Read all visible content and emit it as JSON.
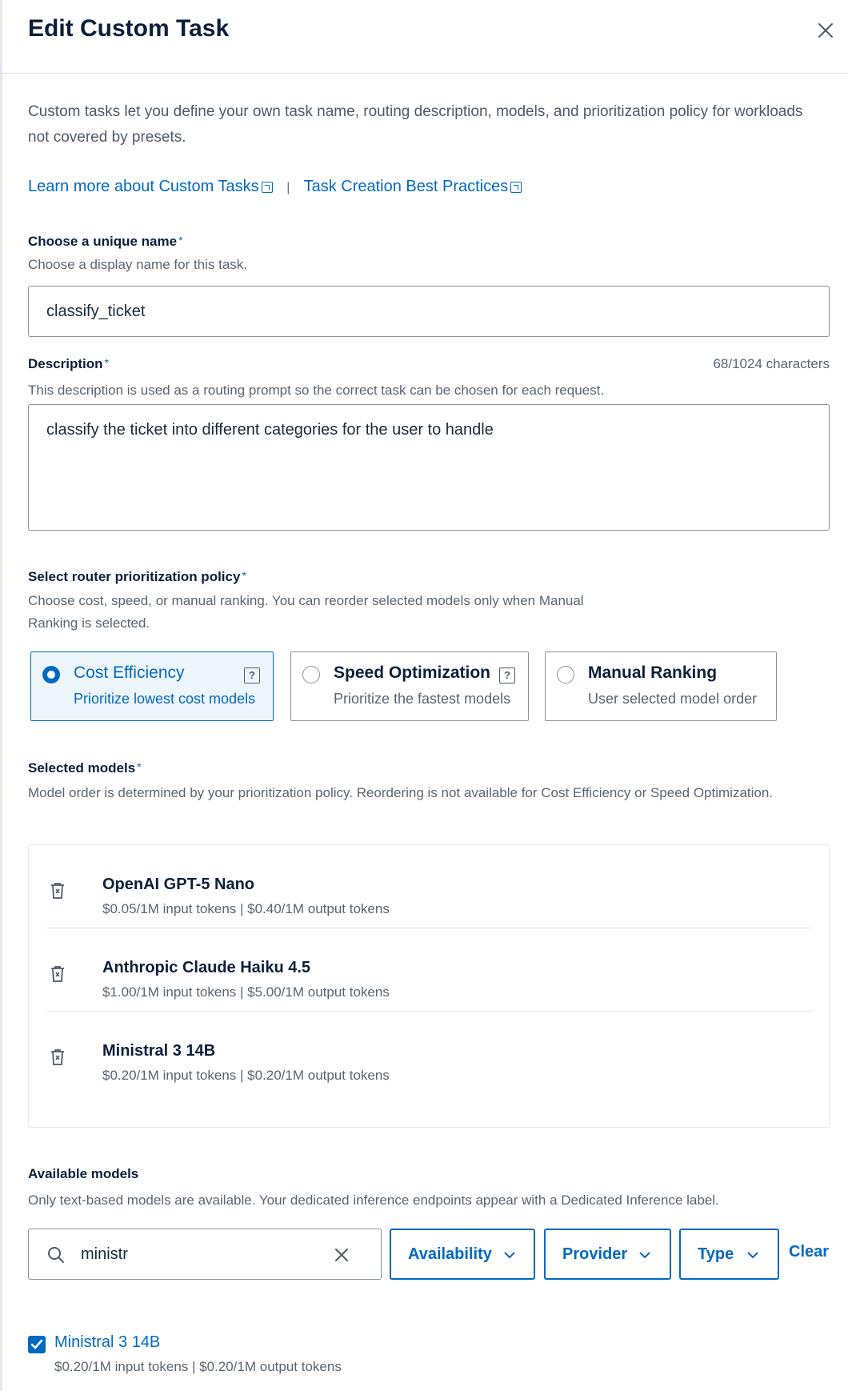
{
  "header": {
    "title": "Edit Custom Task"
  },
  "intro": "Custom tasks let you define your own task name, routing description, models, and prioritization policy for workloads not covered by presets.",
  "links": {
    "learn_more": "Learn more about Custom Tasks",
    "separator": "|",
    "best_practices": "Task Creation Best Practices"
  },
  "name_field": {
    "label": "Choose a unique name",
    "required_mark": "*",
    "help": "Choose a display name for this task.",
    "value": "classify_ticket"
  },
  "description_field": {
    "label": "Description",
    "required_mark": "*",
    "counter": "68/1024 characters",
    "help": "This description is used as a routing prompt so the correct task can be chosen for each request.",
    "value": "classify the ticket into different categories for the user to handle"
  },
  "policy": {
    "label": "Select router prioritization policy",
    "required_mark": "*",
    "help": "Choose cost, speed, or manual ranking. You can reorder selected models only when Manual Ranking is selected.",
    "options": [
      {
        "title": "Cost Efficiency",
        "subtitle": "Prioritize lowest cost models",
        "selected": true,
        "help_icon": "?"
      },
      {
        "title": "Speed Optimization",
        "subtitle": "Prioritize the fastest models",
        "selected": false,
        "help_icon": "?"
      },
      {
        "title": "Manual Ranking",
        "subtitle": "User selected model order",
        "selected": false
      }
    ]
  },
  "selected_models": {
    "label": "Selected models",
    "required_mark": "*",
    "help": "Model order is determined by your prioritization policy. Reordering is not available for Cost Efficiency or Speed Optimization.",
    "items": [
      {
        "name": "OpenAI GPT-5 Nano",
        "price": "$0.05/1M input tokens | $0.40/1M output tokens"
      },
      {
        "name": "Anthropic Claude Haiku 4.5",
        "price": "$1.00/1M input tokens | $5.00/1M output tokens"
      },
      {
        "name": "Ministral 3 14B",
        "price": "$0.20/1M input tokens | $0.20/1M output tokens"
      }
    ]
  },
  "available_models": {
    "label": "Available models",
    "help": "Only text-based models are available. Your dedicated inference endpoints appear with a Dedicated Inference label.",
    "search_value": "ministr",
    "filters": [
      "Availability",
      "Provider",
      "Type"
    ],
    "clear_label": "Clear",
    "results": [
      {
        "name": "Ministral 3 14B",
        "price": "$0.20/1M input tokens | $0.20/1M output tokens",
        "checked": true
      }
    ]
  },
  "colors": {
    "accent": "#0069c2",
    "title": "#0b1f3a",
    "muted": "#5a6572",
    "border": "#8a939c"
  }
}
